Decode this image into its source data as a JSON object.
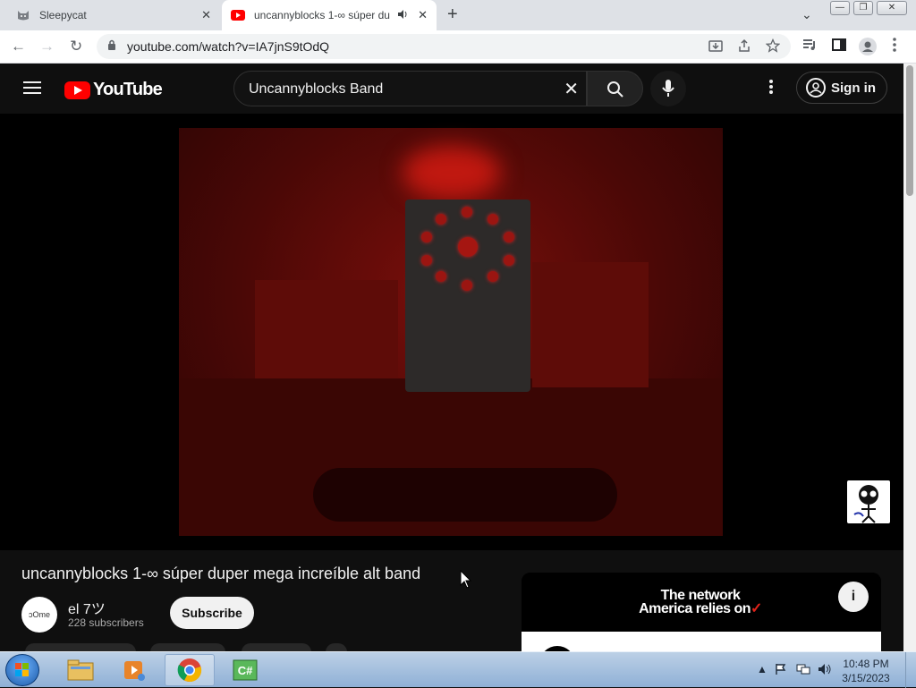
{
  "browser": {
    "tabs": [
      {
        "title": "Sleepycat",
        "favicon": "cat-icon"
      },
      {
        "title": "uncannyblocks 1-∞ súper du",
        "favicon": "youtube-icon",
        "audio_icon": "speaker-icon"
      }
    ],
    "close_glyph": "✕",
    "new_tab_glyph": "+",
    "tab_search_glyph": "⌄",
    "window_buttons": {
      "minimize": "—",
      "restore": "❐",
      "close": "✕"
    },
    "url": "youtube.com/watch?v=IA7jnS9tOdQ",
    "nav": {
      "back": "←",
      "forward": "→",
      "reload": "↻"
    }
  },
  "youtube": {
    "logo_text": "YouTube",
    "search_query": "Uncannyblocks Band",
    "clear_glyph": "✕",
    "sign_in_label": "Sign in",
    "video": {
      "title": "uncannyblocks 1-∞ súper duper mega increíble alt band",
      "channel_name": "el 7ツ",
      "channel_avatar_text": "ɔOme",
      "subscribers": "228 subscribers",
      "subscribe_label": "Subscribe"
    },
    "ad": {
      "line1": "The network",
      "line2": "America relies on",
      "check_glyph": "✓",
      "info_glyph": "i"
    }
  },
  "taskbar": {
    "clock_time": "10:48 PM",
    "clock_date": "3/15/2023",
    "apps": [
      "file-explorer-icon",
      "media-player-icon",
      "chrome-icon",
      "csharp-icon"
    ],
    "csharp_label": "C#"
  },
  "colors": {
    "yt_red": "#ff0000",
    "yt_bg": "#0f0f0f",
    "chrome_frame": "#dee1e6",
    "taskbar": "#9cb8da"
  }
}
